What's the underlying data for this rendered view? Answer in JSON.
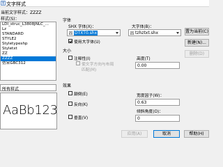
{
  "window": {
    "title": "文字样式"
  },
  "current_style": {
    "label": "当前文字样式：",
    "value": "ZZZZ"
  },
  "styles": {
    "label": "样式(S)：",
    "items": [
      "LDI_struc_L3808JNLC_...",
      "Lz",
      "STANDARD",
      "STYLE2",
      "Styletypeshp",
      "Styletxt",
      "ZZ",
      "ZZZZ",
      "仿宋GBC312"
    ],
    "selected_index": 7
  },
  "filter": {
    "value": "所有样式"
  },
  "preview": {
    "text": "AaBb123"
  },
  "font": {
    "group_label": "字体",
    "shx_label": "SHX 字体(X)：",
    "shx_value": "DTXT0.shx",
    "bigfont_label": "大字体(B)：",
    "bigfont_value": "tzhztxt.shx",
    "use_bigfont_label": "使用大字体(U)",
    "use_bigfont_checked": true
  },
  "size": {
    "group_label": "大小",
    "annotative_label": "注释性(I)",
    "match_orientation_label": "使文字方向与布局",
    "match_orientation_label2": "匹配(M)",
    "height_label": "高度(T)",
    "height_value": "0.00"
  },
  "effects": {
    "group_label": "效果",
    "upside_down_label": "颠倒(E)",
    "backwards_label": "反向(K)",
    "vertical_label": "垂直(V)",
    "width_factor_label": "宽度因子(W)：",
    "width_factor_value": "0.63",
    "oblique_label": "倾斜角度(O)：",
    "oblique_value": "0"
  },
  "buttons": {
    "set_current": "置为当前(C)",
    "new": "新建(N)...",
    "delete": "删除(D)",
    "apply": "应用(A)",
    "cancel": "取消",
    "help": "帮助(H)"
  },
  "colors": {
    "selection": "#0078d7"
  }
}
